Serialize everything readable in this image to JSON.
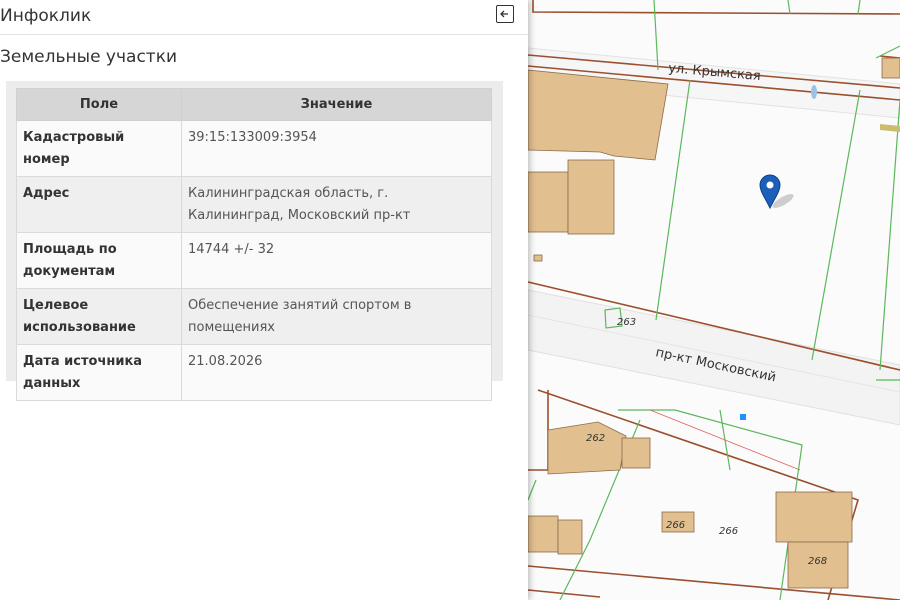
{
  "panel": {
    "title": "Инфоклик",
    "section_title": "Земельные участки",
    "table": {
      "headers": [
        "Поле",
        "Значение"
      ],
      "rows": [
        {
          "field": "Кадастровый номер",
          "value": "39:15:133009:3954"
        },
        {
          "field": "Адрес",
          "value": "Калининградская область, г. Калининград, Московский пр-кт"
        },
        {
          "field": "Площадь по документам",
          "value": "14744 +/- 32"
        },
        {
          "field": "Целевое использование",
          "value": "Обеспечение занятий спортом в помещениях"
        },
        {
          "field": "Дата источника данных",
          "value": "21.08.2026"
        }
      ]
    }
  },
  "map": {
    "street_labels": [
      "ул. Крымская",
      "пр-кт Московский"
    ],
    "building_numbers": [
      "263",
      "262",
      "266",
      "266",
      "268"
    ],
    "colors": {
      "parcel_border": "#9a4f2e",
      "parcel_line_green": "#5cb85c",
      "building_fill": "#e2bf8f",
      "marker": "#1c5fb8"
    }
  }
}
